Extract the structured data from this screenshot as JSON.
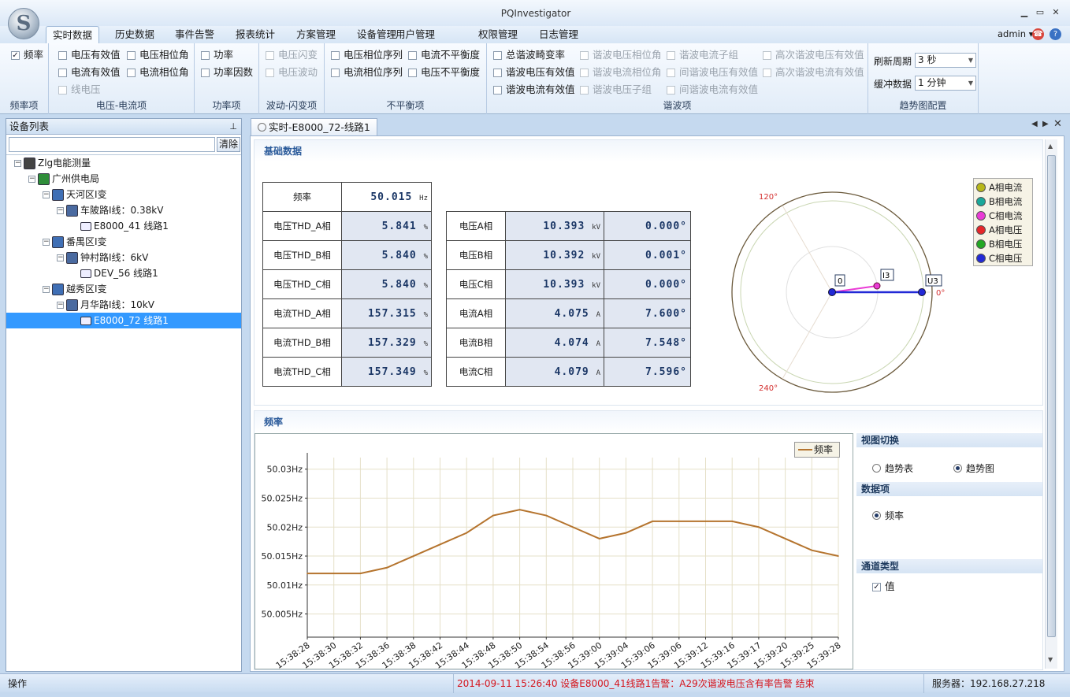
{
  "app": {
    "title": "PQInvestigator"
  },
  "menu": {
    "tabs": [
      "实时数据",
      "历史数据",
      "事件告警",
      "报表统计",
      "方案管理",
      "设备管理",
      "用户管理",
      "权限管理",
      "日志管理"
    ],
    "active_index": 0,
    "user": "admin"
  },
  "ribbon": {
    "groups": {
      "freq": {
        "label": "频率项",
        "items": [
          {
            "label": "频率",
            "checked": true,
            "disabled": false
          }
        ]
      },
      "vi": {
        "label": "电压-电流项",
        "items": [
          {
            "label": "电压有效值",
            "checked": false,
            "disabled": false
          },
          {
            "label": "电压相位角",
            "checked": false,
            "disabled": false
          },
          {
            "label": "电流有效值",
            "checked": false,
            "disabled": false
          },
          {
            "label": "电流相位角",
            "checked": false,
            "disabled": false
          },
          {
            "label": "线电压",
            "checked": false,
            "disabled": true
          }
        ]
      },
      "power": {
        "label": "功率项",
        "items": [
          {
            "label": "功率",
            "checked": false,
            "disabled": false
          },
          {
            "label": "功率因数",
            "checked": false,
            "disabled": false
          }
        ]
      },
      "flicker": {
        "label": "波动-闪变项",
        "items": [
          {
            "label": "电压闪变",
            "checked": false,
            "disabled": true
          },
          {
            "label": "电压波动",
            "checked": false,
            "disabled": true
          }
        ]
      },
      "unbalance": {
        "label": "不平衡项",
        "items": [
          {
            "label": "电压相位序列",
            "checked": false,
            "disabled": false
          },
          {
            "label": "电流不平衡度",
            "checked": false,
            "disabled": false
          },
          {
            "label": "电流相位序列",
            "checked": false,
            "disabled": false
          },
          {
            "label": "电压不平衡度",
            "checked": false,
            "disabled": false
          }
        ]
      },
      "harmonic": {
        "label": "谐波项",
        "items": [
          {
            "label": "总谐波畸变率",
            "checked": false,
            "disabled": false
          },
          {
            "label": "谐波电压相位角",
            "checked": false,
            "disabled": true
          },
          {
            "label": "谐波电流子组",
            "checked": false,
            "disabled": true
          },
          {
            "label": "高次谐波电压有效值",
            "checked": false,
            "disabled": true
          },
          {
            "label": "谐波电压有效值",
            "checked": false,
            "disabled": false
          },
          {
            "label": "谐波电流相位角",
            "checked": false,
            "disabled": true
          },
          {
            "label": "间谐波电压有效值",
            "checked": false,
            "disabled": true
          },
          {
            "label": "高次谐波电流有效值",
            "checked": false,
            "disabled": true
          },
          {
            "label": "谐波电流有效值",
            "checked": false,
            "disabled": false
          },
          {
            "label": "谐波电压子组",
            "checked": false,
            "disabled": true
          },
          {
            "label": "间谐波电流有效值",
            "checked": false,
            "disabled": true
          }
        ]
      },
      "trend": {
        "label": "趋势图配置",
        "refresh_label": "刷新周期",
        "refresh_value": "3 秒",
        "buffer_label": "缓冲数据",
        "buffer_value": "1 分钟"
      }
    }
  },
  "device_panel": {
    "title": "设备列表",
    "search_placeholder": "",
    "clear_button": "清除",
    "tree": [
      {
        "label": "Zlg电能测量",
        "level": 0,
        "icon": "server-icon"
      },
      {
        "label": "广州供电局",
        "level": 1,
        "icon": "bureau-icon"
      },
      {
        "label": "天河区I变",
        "level": 2,
        "icon": "substation-icon"
      },
      {
        "label": "车陂路I线：0.38kV",
        "level": 3,
        "icon": "line-icon"
      },
      {
        "label": "E8000_41 线路1",
        "level": 4,
        "icon": "device-icon"
      },
      {
        "label": "番禺区I变",
        "level": 2,
        "icon": "substation-icon"
      },
      {
        "label": "钟村路I线：6kV",
        "level": 3,
        "icon": "line-icon"
      },
      {
        "label": "DEV_56 线路1",
        "level": 4,
        "icon": "device-icon"
      },
      {
        "label": "越秀区I变",
        "level": 2,
        "icon": "substation-icon"
      },
      {
        "label": "月华路I线：10kV",
        "level": 3,
        "icon": "line-icon"
      },
      {
        "label": "E8000_72 线路1",
        "level": 4,
        "icon": "device-icon",
        "selected": true
      }
    ]
  },
  "document": {
    "tab_title": "实时-E8000_72-线路1",
    "basic_section": "基础数据",
    "freq_label": "频率",
    "freq_value": "50.015",
    "freq_unit": "Hz",
    "thd_rows": [
      {
        "label": "电压THD_A相",
        "value": "5.841",
        "unit": "%"
      },
      {
        "label": "电压THD_B相",
        "value": "5.840",
        "unit": "%"
      },
      {
        "label": "电压THD_C相",
        "value": "5.840",
        "unit": "%"
      },
      {
        "label": "电流THD_A相",
        "value": "157.315",
        "unit": "%"
      },
      {
        "label": "电流THD_B相",
        "value": "157.329",
        "unit": "%"
      },
      {
        "label": "电流THD_C相",
        "value": "157.349",
        "unit": "%"
      }
    ],
    "phase_rows": [
      {
        "label": "电压A相",
        "value": "10.393",
        "unit": "kV",
        "angle": "0.000°"
      },
      {
        "label": "电压B相",
        "value": "10.392",
        "unit": "kV",
        "angle": "0.001°"
      },
      {
        "label": "电压C相",
        "value": "10.393",
        "unit": "kV",
        "angle": "0.000°"
      },
      {
        "label": "电流A相",
        "value": "4.075",
        "unit": "A",
        "angle": "7.600°"
      },
      {
        "label": "电流B相",
        "value": "4.074",
        "unit": "A",
        "angle": "7.548°"
      },
      {
        "label": "电流C相",
        "value": "4.079",
        "unit": "A",
        "angle": "7.596°"
      }
    ],
    "phasor": {
      "angle_labels": [
        "120°",
        "240°",
        "0°"
      ],
      "point_labels": [
        "0",
        "I3",
        "U3"
      ],
      "legend": [
        {
          "label": "A相电流",
          "color": "#b8b81a"
        },
        {
          "label": "B相电流",
          "color": "#1aa89a"
        },
        {
          "label": "C相电流",
          "color": "#ea3bd6"
        },
        {
          "label": "A相电压",
          "color": "#e6262a"
        },
        {
          "label": "B相电压",
          "color": "#23a823"
        },
        {
          "label": "C相电压",
          "color": "#2229d6"
        }
      ]
    },
    "freq_section": "频率",
    "legend_label": "频率",
    "view_switch": {
      "title": "视图切换",
      "table": "趋势表",
      "chart": "趋势图",
      "selected": "chart"
    },
    "data_item": {
      "title": "数据项",
      "option": "频率"
    },
    "channel_type": {
      "title": "通道类型",
      "option": "值",
      "checked": true
    }
  },
  "chart_data": {
    "type": "line",
    "ylabel": "",
    "xlabel": "",
    "y_ticks": [
      "50.03Hz",
      "50.025Hz",
      "50.02Hz",
      "50.015Hz",
      "50.01Hz",
      "50.005Hz"
    ],
    "ylim": [
      50.001,
      50.032
    ],
    "categories": [
      "15:38:28",
      "15:38:30",
      "15:38:32",
      "15:38:36",
      "15:38:38",
      "15:38:42",
      "15:38:44",
      "15:38:48",
      "15:38:50",
      "15:38:54",
      "15:38:56",
      "15:39:00",
      "15:39:04",
      "15:39:06",
      "15:39:06",
      "15:39:12",
      "15:39:16",
      "15:39:17",
      "15:39:20",
      "15:39:25",
      "15:39:28"
    ],
    "series": [
      {
        "name": "频率",
        "color": "#b5742e",
        "values": [
          50.012,
          50.012,
          50.012,
          50.013,
          50.015,
          50.017,
          50.019,
          50.022,
          50.023,
          50.022,
          50.02,
          50.018,
          50.019,
          50.021,
          50.021,
          50.021,
          50.021,
          50.02,
          50.018,
          50.016,
          50.015
        ]
      }
    ]
  },
  "status": {
    "left": "操作",
    "alarm": "2014-09-11 15:26:40 设备E8000_41线路1告警：A29次谐波电压含有率告警 结束",
    "alarm_color": "#d4141c",
    "server": "服务器：192.168.27.218"
  }
}
